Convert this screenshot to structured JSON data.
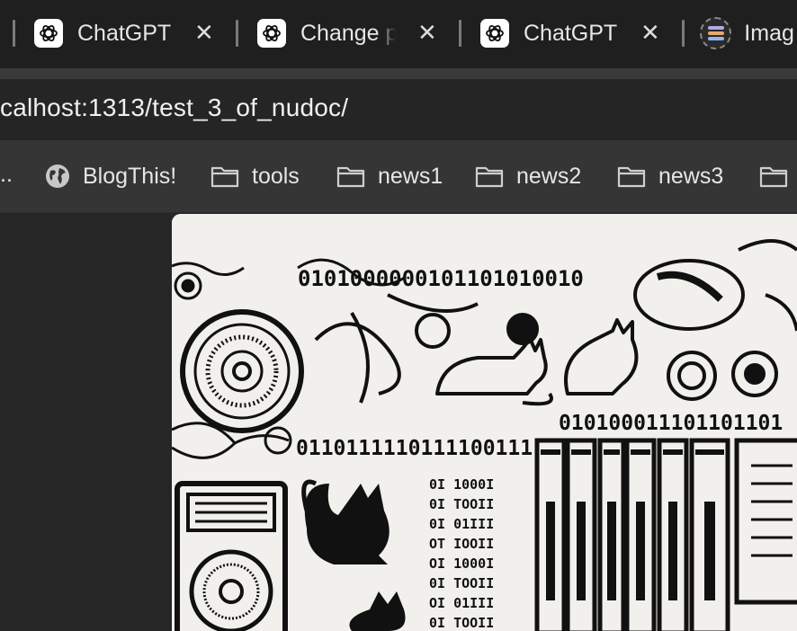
{
  "tabs": [
    {
      "title": "ChatGPT",
      "icon": "openai-logo-icon"
    },
    {
      "title": "Change p",
      "icon": "openai-logo-icon"
    },
    {
      "title": "ChatGPT",
      "icon": "openai-logo-icon"
    },
    {
      "title": "Imag",
      "icon": "image-app-icon"
    }
  ],
  "close_glyph": "✕",
  "address_bar": {
    "url": "calhost:1313/test_3_of_nudoc/"
  },
  "bookmarks": {
    "overflow_label": "..",
    "items": [
      {
        "label": "BlogThis!",
        "icon": "globe-icon"
      },
      {
        "label": "tools",
        "icon": "folder-icon"
      },
      {
        "label": "news1",
        "icon": "folder-icon"
      },
      {
        "label": "news2",
        "icon": "folder-icon"
      },
      {
        "label": "news3",
        "icon": "folder-icon"
      }
    ]
  },
  "artwork": {
    "binary_rows": [
      "0101000000101101010010",
      "010100011101101101",
      "0110111110111100111"
    ]
  },
  "colors": {
    "tabbar": "#1f1f20",
    "bookmarks_bar": "#353536",
    "content_bg": "#262627",
    "image_paper": "#f1f0ec"
  }
}
